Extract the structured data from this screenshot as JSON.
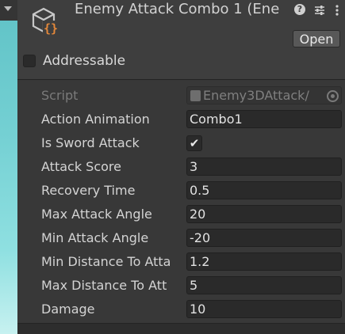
{
  "header": {
    "title": "Enemy Attack Combo 1 (Ene",
    "icons": [
      "scriptable-object-icon",
      "help-icon",
      "preset-icon",
      "more-options-icon"
    ],
    "open_label": "Open",
    "addressable_label": "Addressable",
    "addressable_checked": false
  },
  "script": {
    "label": "Script",
    "value": "Enemy3DAttack/"
  },
  "properties": {
    "action_animation": {
      "label": "Action Animation",
      "value": "Combo1"
    },
    "is_sword_attack": {
      "label": "Is Sword Attack",
      "checked": true,
      "check_glyph": "✔"
    },
    "attack_score": {
      "label": "Attack Score",
      "value": "3"
    },
    "recovery_time": {
      "label": "Recovery Time",
      "value": "0.5"
    },
    "max_attack_angle": {
      "label": "Max Attack Angle",
      "value": "20"
    },
    "min_attack_angle": {
      "label": "Min Attack Angle",
      "value": "-20"
    },
    "min_distance": {
      "label": "Min Distance To Atta",
      "value": "1.2"
    },
    "max_distance": {
      "label": "Max Distance To Att",
      "value": "5"
    },
    "damage": {
      "label": "Damage",
      "value": "10"
    }
  },
  "colors": {
    "panel_bg": "#383838",
    "header_bg": "#3e3e3e",
    "field_bg": "#2a2a2a",
    "scene_teal": "#74d0d3",
    "icon_orange": "#e4883a"
  }
}
